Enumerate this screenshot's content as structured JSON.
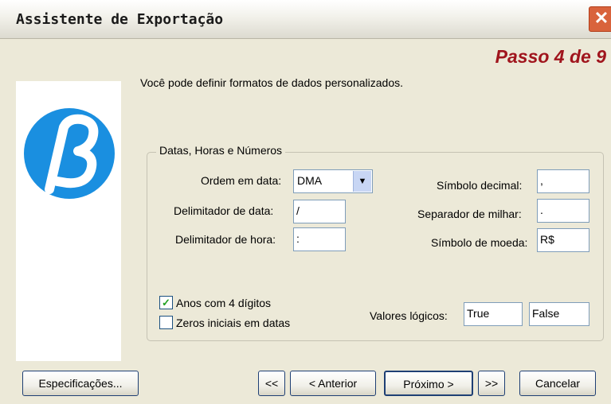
{
  "window": {
    "title": "Assistente de Exportação",
    "close_glyph": "✕"
  },
  "step": "Passo 4 de 9",
  "intro": "Você pode definir formatos de dados personalizados.",
  "logo": {
    "icon": "beta-logo-icon",
    "color": "#1a8fe0"
  },
  "group": {
    "title": "Datas, Horas e Números",
    "date_order": {
      "label": "Ordem em data:",
      "value": "DMA"
    },
    "date_delimiter": {
      "label": "Delimitador de data:",
      "value": "/"
    },
    "time_delimiter": {
      "label": "Delimitador de hora:",
      "value": ":"
    },
    "decimal_symbol": {
      "label": "Símbolo decimal:",
      "value": ","
    },
    "thousands_separator": {
      "label": "Separador de milhar:",
      "value": "."
    },
    "currency_symbol": {
      "label": "Símbolo de moeda:",
      "value": "R$"
    },
    "four_digit_years": {
      "label": "Anos com 4 dígitos",
      "checked": true
    },
    "leading_zeros": {
      "label": "Zeros iniciais em datas",
      "checked": false
    },
    "logical_values": {
      "label": "Valores lógicos:",
      "true_value": "True",
      "false_value": "False"
    }
  },
  "buttons": {
    "specs": "Especificações...",
    "first": "<<",
    "back": "< Anterior",
    "next": "Próximo >",
    "last": ">>",
    "cancel": "Cancelar"
  }
}
